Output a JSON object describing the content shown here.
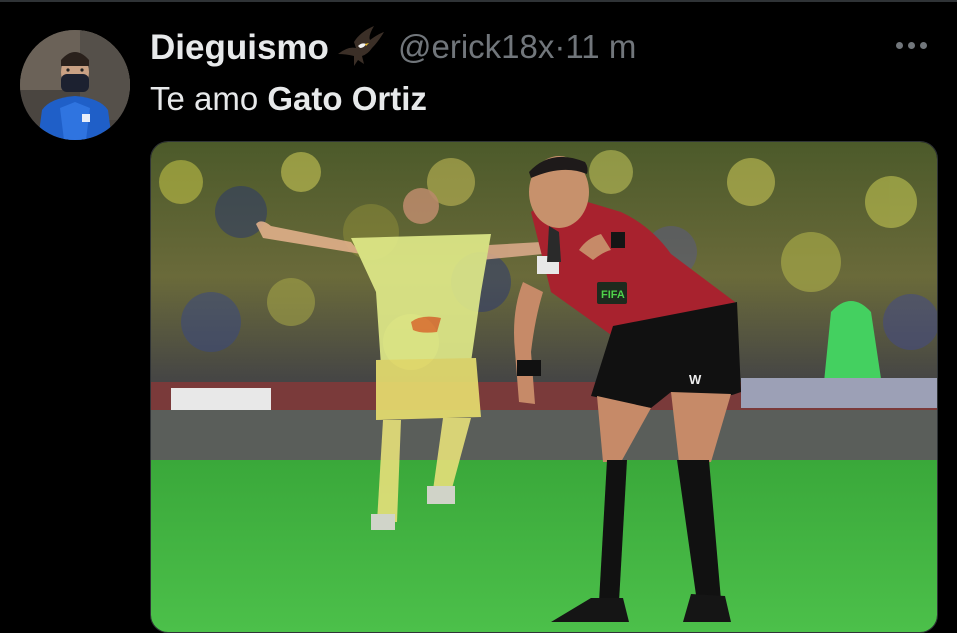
{
  "tweet": {
    "display_name": "Dieguismo",
    "handle": "@erick18x",
    "separator": "·",
    "time": "11 m",
    "text_prefix": "Te amo ",
    "text_bold": "Gato Ortiz",
    "name_emoji": "eagle-icon",
    "more_icon": "more-options-icon"
  },
  "media": {
    "kit_sponsor": "W",
    "badge": "FIFA"
  },
  "colors": {
    "background": "#000000",
    "text_primary": "#e7e9ea",
    "text_secondary": "#71767b"
  }
}
